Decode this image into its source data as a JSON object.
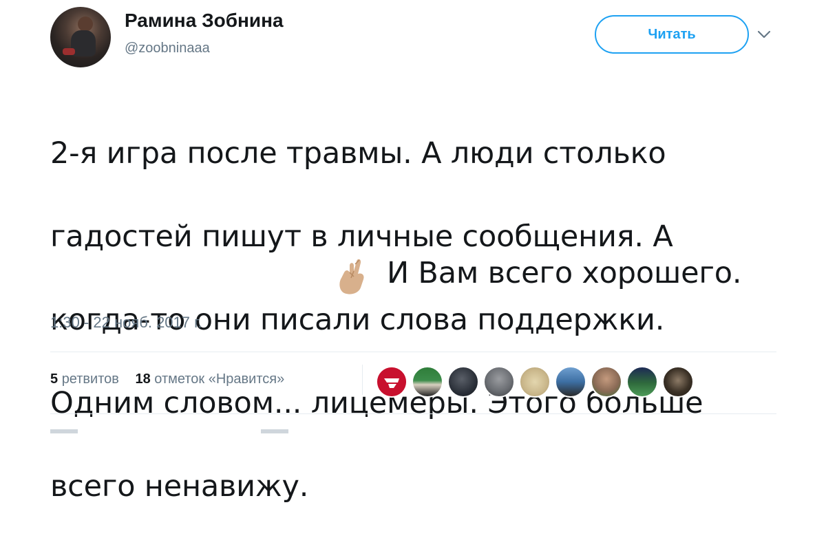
{
  "tweet": {
    "author_name": "Рамина Зобнина",
    "author_handle": "@zoobninaaa",
    "follow_label": "Читать",
    "text_lines": [
      "2-я игра после травмы. А люди столько",
      "гадостей пишут в личные сообщения. А",
      "когда-то они писали слова поддержки.",
      "Одним словом... лицемеры. Этого больше",
      "всего ненавижу."
    ],
    "text_after_emoji": "И Вам всего хорошего.",
    "emoji": "crossed-fingers-emoji",
    "timestamp": "1:30 - 22 нояб. 2017 г."
  },
  "stats": {
    "retweets_count": "5",
    "retweets_label": "ретвитов",
    "likes_count": "18",
    "likes_label": "отметок «Нравится»"
  },
  "likers": [
    {
      "icon": "spartak-logo-avatar",
      "color": "#c8102e"
    },
    {
      "icon": "tropical-avatar",
      "color": "#3c8c4a"
    },
    {
      "icon": "dark-photo-avatar",
      "color": "#2a2f38"
    },
    {
      "icon": "person-avatar",
      "color": "#6b6e73"
    },
    {
      "icon": "map-avatar",
      "color": "#c9b68a"
    },
    {
      "icon": "plane-avatar",
      "color": "#3d6fa3"
    },
    {
      "icon": "man-avatar",
      "color": "#8a6a55"
    },
    {
      "icon": "stadium-avatar",
      "color": "#2f6b3c"
    },
    {
      "icon": "hair-avatar",
      "color": "#3b3126"
    }
  ],
  "colors": {
    "accent": "#1da1f2",
    "secondary_text": "#657786",
    "primary_text": "#14171a",
    "divider": "#e6ecf0"
  }
}
